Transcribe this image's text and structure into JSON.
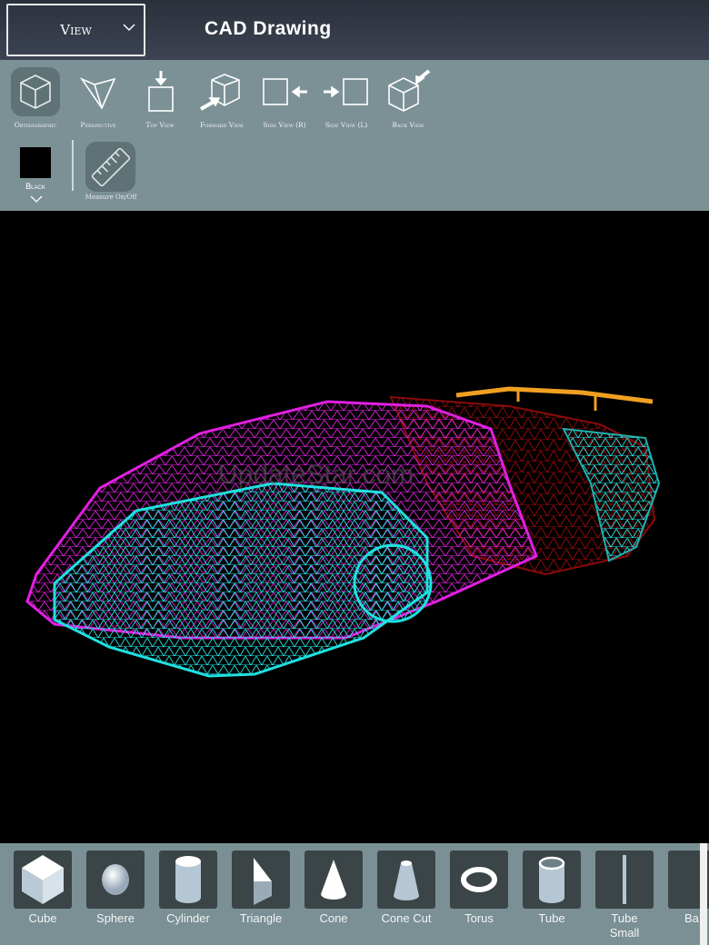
{
  "header": {
    "view_button": "View",
    "title": "CAD Drawing"
  },
  "toolbar": {
    "tools": [
      {
        "label": "Orthographic",
        "selected": true
      },
      {
        "label": "Perspective"
      },
      {
        "label": "Top View"
      },
      {
        "label": "Forward View"
      },
      {
        "label": "Side View (R)"
      },
      {
        "label": "Side View (L)"
      },
      {
        "label": "Back View"
      }
    ],
    "color": {
      "label": "Black",
      "value": "#000000"
    },
    "measure": {
      "label": "Measure On/Off"
    }
  },
  "viewport": {
    "watermark": "UpdateStar.com"
  },
  "shapes": [
    {
      "label": "Cube"
    },
    {
      "label": "Sphere"
    },
    {
      "label": "Cylinder"
    },
    {
      "label": "Triangle"
    },
    {
      "label": "Cone"
    },
    {
      "label": "Cone Cut"
    },
    {
      "label": "Torus"
    },
    {
      "label": "Tube"
    },
    {
      "label": "Tube Small"
    },
    {
      "label": "Ba"
    }
  ],
  "colors": {
    "toolbar": "#7b9195",
    "magenta": "#e020e0",
    "cyan": "#20e0e0",
    "red": "#8a0a0a",
    "orange": "#f0a020"
  }
}
